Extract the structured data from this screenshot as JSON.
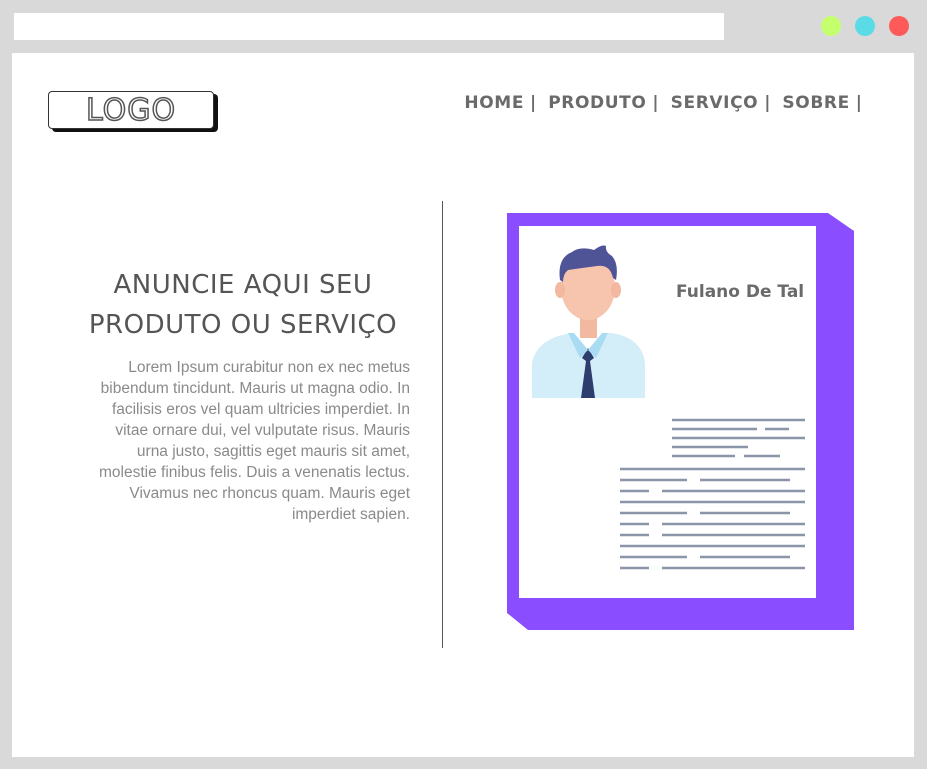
{
  "browser": {
    "window_dots": [
      "#c4ff6e",
      "#5adbe6",
      "#ff5a5a"
    ]
  },
  "header": {
    "logo_text": "LOGO",
    "nav": [
      {
        "label": "HOME",
        "sep": "|"
      },
      {
        "label": "PRODUTO",
        "sep": "|"
      },
      {
        "label": "SERVIÇO",
        "sep": "|"
      },
      {
        "label": "SOBRE",
        "sep": "|"
      }
    ]
  },
  "hero": {
    "headline_line1": "ANUNCIE AQUI SEU",
    "headline_line2": "PRODUTO OU SERVIÇO",
    "body": "Lorem Ipsum curabitur non ex nec metus bibendum tincidunt. Mauris ut magna odio. In facilisis eros vel quam ultricies imperdiet. In vitae ornare dui, vel vulputate risus. Mauris urna justo, sagittis eget mauris sit amet, molestie finibus felis. Duis a venenatis lectus. Vivamus nec rhoncus quam. Mauris eget imperdiet sapien."
  },
  "profile_card": {
    "name": "Fulano De Tal",
    "accent_color": "#8a4dff",
    "avatar_icon": "person-avatar-icon"
  }
}
